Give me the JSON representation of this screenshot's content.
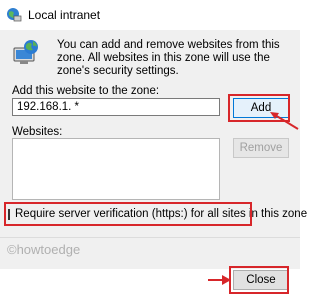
{
  "window": {
    "title": "Local intranet",
    "title_icon": "globe-computer-icon"
  },
  "info": {
    "icon": "globe-computer-icon",
    "text": "You can add and remove websites from this zone. All websites in this zone will use the zone's security settings."
  },
  "add_section": {
    "label": "Add this website to the zone:",
    "input_value": "192.168.1. *",
    "add_button": "Add"
  },
  "websites_section": {
    "label": "Websites:",
    "remove_button": "Remove"
  },
  "verification": {
    "label": "Require server verification (https:) for all sites in this zone",
    "checked": false
  },
  "footer": {
    "close_button": "Close",
    "watermark": "©howtoedge"
  },
  "colors": {
    "highlight": "#d7262a",
    "dialog_bg": "#f0f0f0",
    "accent_border": "#0078d7"
  }
}
